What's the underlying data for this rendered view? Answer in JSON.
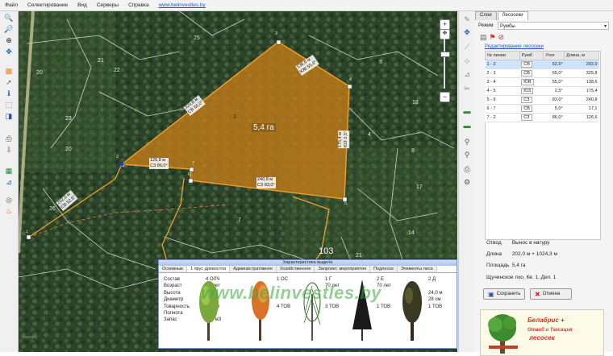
{
  "menu": [
    "Файл",
    "Селектирование",
    "Вид",
    "Серверы",
    "Справка"
  ],
  "menu_link": "www.belinvestles.by",
  "map": {
    "plot_area": "5,4 га",
    "plot_index": "3",
    "quarter_number": "103",
    "compartments": [
      "25",
      "21",
      "22",
      "20",
      "23",
      "20",
      "26",
      "7",
      "4",
      "8",
      "14",
      "9",
      "18",
      "17",
      "21"
    ],
    "vertices": [
      "1",
      "2",
      "3",
      "4",
      "5",
      "6",
      "7"
    ],
    "dimensions": [
      {
        "len": "202,0 м",
        "az": "СВ 52,5°"
      },
      {
        "len": "126,8 м",
        "az": "СЗ 86,0°"
      },
      {
        "len": "325,8 м",
        "az": "СВ 65,0°"
      },
      {
        "len": "138,6 м",
        "az": "ЮВ 55,0°"
      },
      {
        "len": "175,4 м",
        "az": "ЮЗ 2,5°"
      },
      {
        "len": "240,8 м",
        "az": "СЗ 83,0°"
      }
    ]
  },
  "panel": {
    "tabs": [
      "Слои",
      "Лесосеки"
    ],
    "mode_label": "Режим",
    "mode_value": "Румбы",
    "edit_link": "Редактирование лесосеки",
    "table_headers": [
      "№ линии",
      "Румб",
      "Угол",
      "Длина, м"
    ],
    "rows": [
      {
        "line": "1 - 2",
        "rumb": "СВ",
        "angle": "52,5°",
        "len": "202,0"
      },
      {
        "line": "2 - 3",
        "rumb": "СВ",
        "angle": "65,0°",
        "len": "325,8"
      },
      {
        "line": "3 - 4",
        "rumb": "ЮВ",
        "angle": "55,0°",
        "len": "138,6"
      },
      {
        "line": "4 - 5",
        "rumb": "ЮЗ",
        "angle": "2,5°",
        "len": "175,4"
      },
      {
        "line": "5 - 6",
        "rumb": "СЗ",
        "angle": "83,0°",
        "len": "240,8"
      },
      {
        "line": "6 - 7",
        "rumb": "СВ",
        "angle": "5,0°",
        "len": "17,1"
      },
      {
        "line": "7 - 2",
        "rumb": "СЗ",
        "angle": "86,0°",
        "len": "126,6"
      }
    ],
    "otvod_label": "Отвод",
    "otvod_value": "Вынос в натуру",
    "length_label": "Длина",
    "length_value": "202,0 м + 1024,3 м",
    "area_label": "Площадь",
    "area_value": "5,4 га",
    "location": "Щучинское лхо, Кв. 1, Дел. 1",
    "save_label": "Сохранить",
    "cancel_label": "Отмена",
    "logo_line1": "Белабрис +",
    "logo_line2": "Отвод и Таксация",
    "logo_line3": "лесосек"
  },
  "dialog": {
    "title": "Характеристика выдела",
    "tabs": [
      "Основные",
      "1 ярус древостоя",
      "Административное",
      "Хозяйственное",
      "Запроект. мероприятия",
      "Подлесок",
      "Элементы леса"
    ],
    "labels": [
      "Состав",
      "Возраст",
      "Высота",
      "Диаметр",
      "Товарность",
      "Полнота",
      "Запас"
    ],
    "columns": [
      [
        "4 ОЛЧ",
        "60 лет",
        "",
        "",
        "2 ТОВ",
        "0,7",
        "330 м3"
      ],
      [
        "1 ОС",
        "",
        "",
        "",
        "4 ТОВ",
        "",
        ""
      ],
      [
        "1 Г",
        "70 лет",
        "",
        "",
        "3 ТОВ",
        "",
        ""
      ],
      [
        "2 Е",
        "70 лет",
        "",
        "",
        "1 ТОВ",
        "",
        ""
      ],
      [
        "2 Д",
        "",
        "24,0 м",
        "28 см",
        "1 ТОВ",
        "",
        ""
      ]
    ],
    "watermark": "www.belinvestles.by"
  },
  "colors": {
    "plot_fill": "#c07a1a",
    "plot_line": "#f0a030",
    "accent": "#2255cc"
  }
}
